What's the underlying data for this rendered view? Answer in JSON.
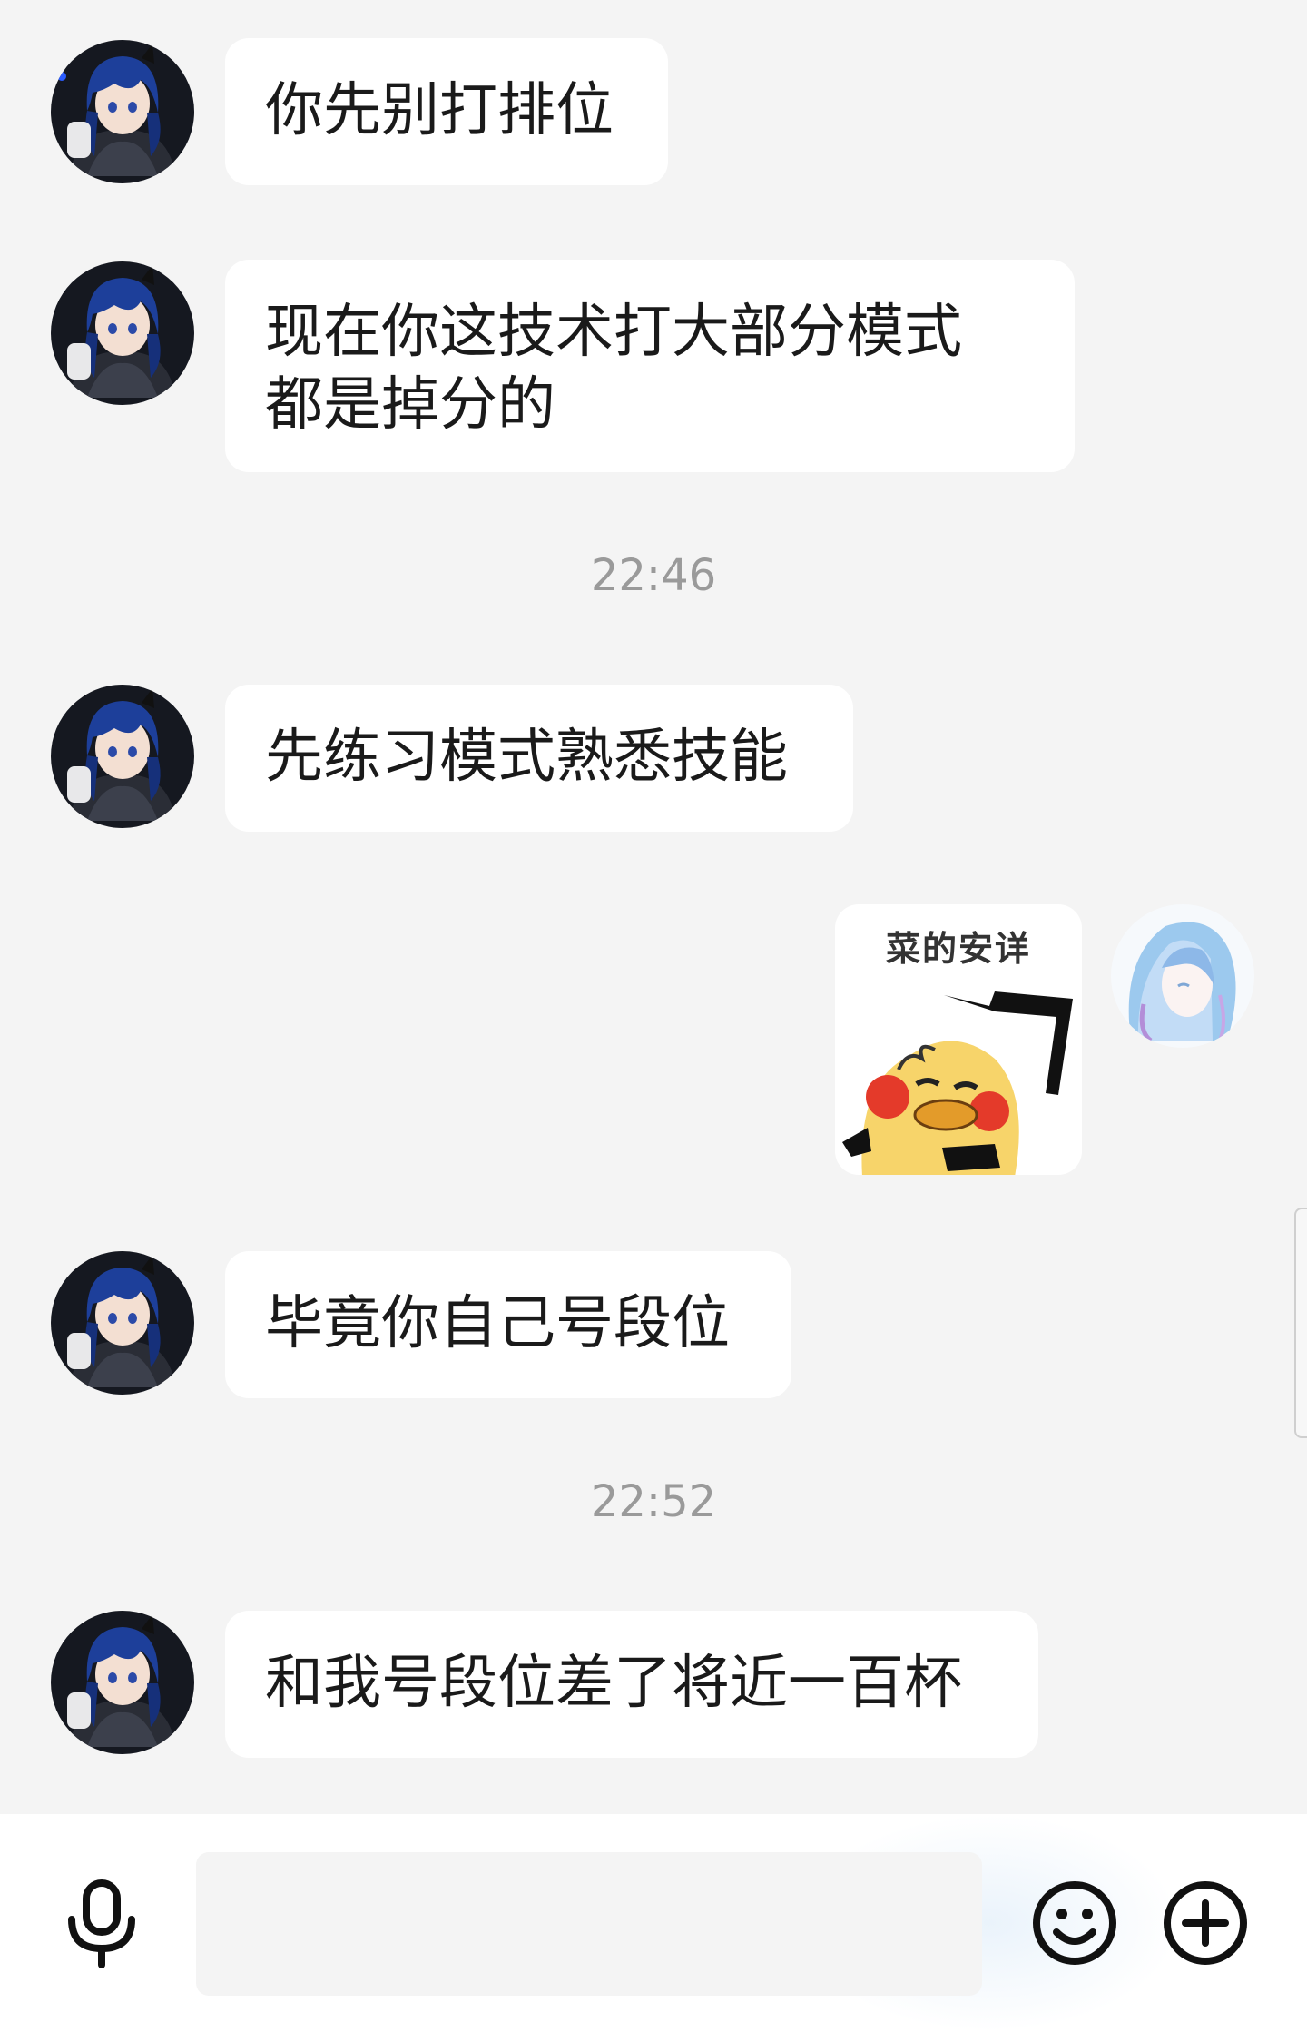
{
  "messages": [
    {
      "sender": "friend",
      "text": "你先别打排位"
    },
    {
      "sender": "friend",
      "text": "现在你这技术打大部分模式\n都是掉分的"
    },
    {
      "type": "timestamp",
      "text": "22:46"
    },
    {
      "sender": "friend",
      "text": "先练习模式熟悉技能"
    },
    {
      "sender": "me",
      "type": "sticker",
      "caption": "菜的安详"
    },
    {
      "sender": "friend",
      "text": "毕竟你自己号段位"
    },
    {
      "type": "timestamp",
      "text": "22:52"
    },
    {
      "sender": "friend",
      "text": "和我号段位差了将近一百杯"
    }
  ],
  "input_bar": {
    "left_icon": "microphone-icon",
    "placeholder": "",
    "value": "",
    "right_icons": [
      "emoji-icon",
      "plus-circle-icon"
    ]
  },
  "colors": {
    "background": "#f4f4f4",
    "bubble": "#ffffff",
    "timestamp_text": "#9a9a9a",
    "friend_avatar_hair": "#1d3f9a",
    "my_avatar_hair": "#9cc9ee"
  }
}
